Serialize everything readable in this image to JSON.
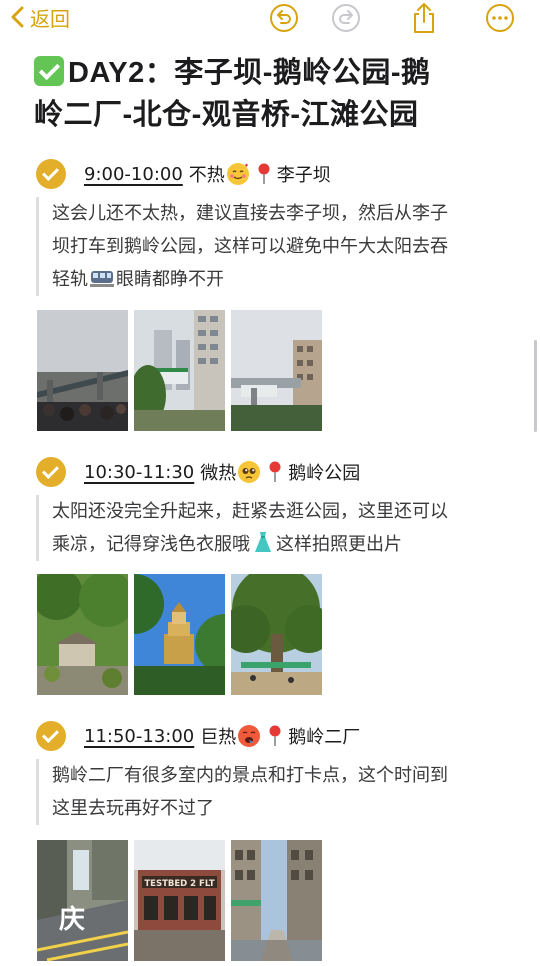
{
  "toolbar": {
    "back_label": "返回",
    "accent_color": "#d7a40f",
    "icons": [
      "chevron-left-icon",
      "undo-icon",
      "redo-icon",
      "share-icon",
      "more-icon"
    ]
  },
  "note": {
    "title_line1": "DAY2：李子坝-鹅岭公园-鹅",
    "title_line2": "岭二厂-北仓-观音桥-江滩公园"
  },
  "sections": [
    {
      "time": "9:00-10:00",
      "weather": "不热",
      "place": "李子坝",
      "desc_line1": "这会儿还不太热，建议直接去李子坝，然后从李子",
      "desc_line2": "坝打车到鹅岭公园，这样可以避免中午大太阳去吞",
      "desc_line3_a": "轻轨",
      "desc_line3_b": "眼睛都睁不开"
    },
    {
      "time": "10:30-11:30",
      "weather": "微热",
      "place": "鹅岭公园",
      "desc_line1": "太阳还没完全升起来，赶紧去逛公园，这里还可以",
      "desc_line2_a": "乘凉，记得穿浅色衣服哦",
      "desc_line2_b": "这样拍照更出片"
    },
    {
      "time": "11:50-13:00",
      "weather": "巨热",
      "place": "鹅岭二厂",
      "desc_line1": "鹅岭二厂有很多室内的景点和打卡点，这个时间到",
      "desc_line2": "这里去玩再好不过了",
      "photo_sign": "TESTBED 2 FLT",
      "photo_text": "庆"
    }
  ]
}
